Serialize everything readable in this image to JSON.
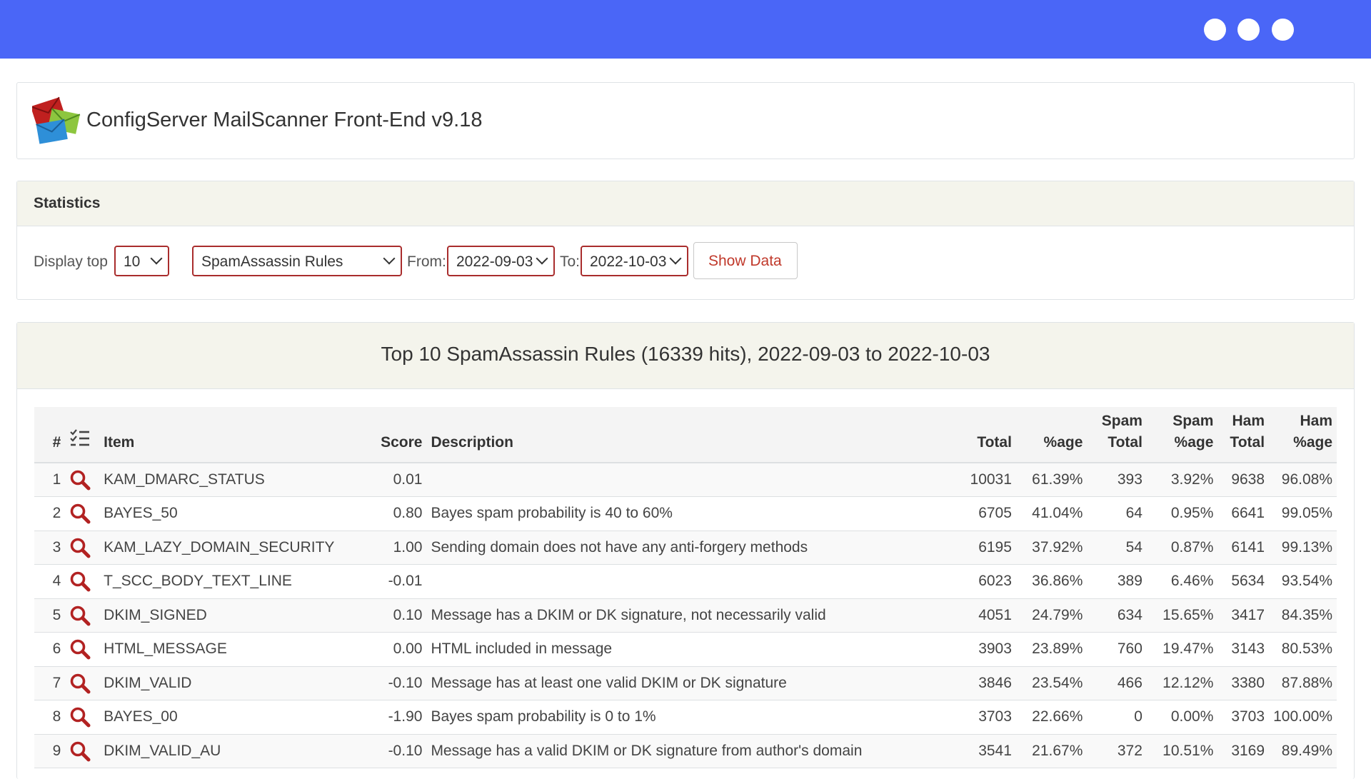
{
  "app": {
    "title": "ConfigServer MailScanner Front-End v9.18"
  },
  "statistics": {
    "heading": "Statistics",
    "display_top_label": "Display top",
    "top_value": "10",
    "type_value": "SpamAssassin Rules",
    "from_label": "From:",
    "from_value": "2022-09-03",
    "to_label": "To:",
    "to_value": "2022-10-03",
    "show_button": "Show Data"
  },
  "result": {
    "title": "Top 10 SpamAssassin Rules (16339 hits), 2022-09-03 to 2022-10-03",
    "columns": {
      "num": "#",
      "item": "Item",
      "score": "Score",
      "description": "Description",
      "total": "Total",
      "pct": "%age",
      "spam_total_1": "Spam",
      "spam_total_2": "Total",
      "spam_pct_1": "Spam",
      "spam_pct_2": "%age",
      "ham_total_1": "Ham",
      "ham_total_2": "Total",
      "ham_pct_1": "Ham",
      "ham_pct_2": "%age"
    },
    "rows": [
      {
        "num": "1",
        "item": "KAM_DMARC_STATUS",
        "score": "0.01",
        "description": "",
        "total": "10031",
        "pct": "61.39%",
        "spam_total": "393",
        "spam_pct": "3.92%",
        "ham_total": "9638",
        "ham_pct": "96.08%"
      },
      {
        "num": "2",
        "item": "BAYES_50",
        "score": "0.80",
        "description": "Bayes spam probability is 40 to 60%",
        "total": "6705",
        "pct": "41.04%",
        "spam_total": "64",
        "spam_pct": "0.95%",
        "ham_total": "6641",
        "ham_pct": "99.05%"
      },
      {
        "num": "3",
        "item": "KAM_LAZY_DOMAIN_SECURITY",
        "score": "1.00",
        "description": "Sending domain does not have any anti-forgery methods",
        "total": "6195",
        "pct": "37.92%",
        "spam_total": "54",
        "spam_pct": "0.87%",
        "ham_total": "6141",
        "ham_pct": "99.13%"
      },
      {
        "num": "4",
        "item": "T_SCC_BODY_TEXT_LINE",
        "score": "-0.01",
        "description": "",
        "total": "6023",
        "pct": "36.86%",
        "spam_total": "389",
        "spam_pct": "6.46%",
        "ham_total": "5634",
        "ham_pct": "93.54%"
      },
      {
        "num": "5",
        "item": "DKIM_SIGNED",
        "score": "0.10",
        "description": "Message has a DKIM or DK signature, not necessarily valid",
        "total": "4051",
        "pct": "24.79%",
        "spam_total": "634",
        "spam_pct": "15.65%",
        "ham_total": "3417",
        "ham_pct": "84.35%"
      },
      {
        "num": "6",
        "item": "HTML_MESSAGE",
        "score": "0.00",
        "description": "HTML included in message",
        "total": "3903",
        "pct": "23.89%",
        "spam_total": "760",
        "spam_pct": "19.47%",
        "ham_total": "3143",
        "ham_pct": "80.53%"
      },
      {
        "num": "7",
        "item": "DKIM_VALID",
        "score": "-0.10",
        "description": "Message has at least one valid DKIM or DK signature",
        "total": "3846",
        "pct": "23.54%",
        "spam_total": "466",
        "spam_pct": "12.12%",
        "ham_total": "3380",
        "ham_pct": "87.88%"
      },
      {
        "num": "8",
        "item": "BAYES_00",
        "score": "-1.90",
        "description": "Bayes spam probability is 0 to 1%",
        "total": "3703",
        "pct": "22.66%",
        "spam_total": "0",
        "spam_pct": "0.00%",
        "ham_total": "3703",
        "ham_pct": "100.00%"
      },
      {
        "num": "9",
        "item": "DKIM_VALID_AU",
        "score": "-0.10",
        "description": "Message has a valid DKIM or DK signature from author's domain",
        "total": "3541",
        "pct": "21.67%",
        "spam_total": "372",
        "spam_pct": "10.51%",
        "ham_total": "3169",
        "ham_pct": "89.49%"
      }
    ]
  },
  "icons": {
    "row_action": "search-icon",
    "column_list": "list-icon"
  },
  "colors": {
    "topbar": "#4a66f7",
    "accent": "#a92d2d",
    "button_text": "#c0392b"
  }
}
